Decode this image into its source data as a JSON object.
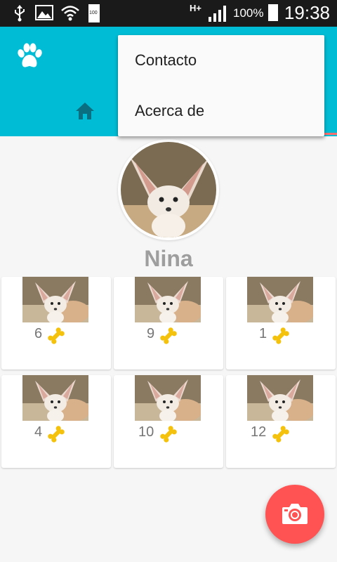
{
  "status_bar": {
    "battery_percent": "100%",
    "battery_icon_text": "100",
    "time": "19:38",
    "network_type": "H+"
  },
  "overflow_menu": {
    "items": [
      {
        "label": "Contacto"
      },
      {
        "label": "Acerca de"
      }
    ]
  },
  "profile": {
    "name": "Nina"
  },
  "grid": {
    "items": [
      {
        "likes": "6"
      },
      {
        "likes": "9"
      },
      {
        "likes": "1"
      },
      {
        "likes": "4"
      },
      {
        "likes": "10"
      },
      {
        "likes": "12"
      }
    ]
  },
  "colors": {
    "app_bar": "#00bcd4",
    "fab": "#ff5252",
    "bone": "#f4c20d"
  },
  "icons": {
    "app_logo": "paw-icon",
    "tab_home": "home-icon",
    "fab": "camera-icon",
    "like": "bone-icon"
  }
}
